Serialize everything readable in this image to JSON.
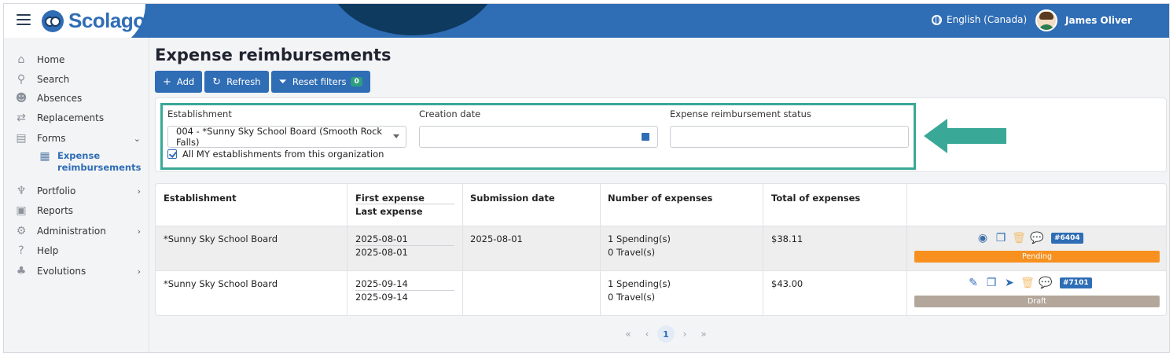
{
  "header": {
    "brand": "Scolago",
    "language": "English (Canada)",
    "user_name": "James Oliver"
  },
  "sidebar": {
    "items": [
      {
        "label": "Home",
        "icon": "home-icon"
      },
      {
        "label": "Search",
        "icon": "search-icon"
      },
      {
        "label": "Absences",
        "icon": "absences-icon"
      },
      {
        "label": "Replacements",
        "icon": "replacements-icon"
      },
      {
        "label": "Forms",
        "icon": "forms-icon"
      },
      {
        "label": "Portfolio",
        "icon": "trophy-icon"
      },
      {
        "label": "Reports",
        "icon": "reports-icon"
      },
      {
        "label": "Administration",
        "icon": "gear-icon"
      },
      {
        "label": "Help",
        "icon": "help-icon"
      },
      {
        "label": "Evolutions",
        "icon": "sprout-icon"
      }
    ],
    "sub_item": {
      "label": "Expense reimbursements",
      "icon": "document-icon"
    }
  },
  "page": {
    "title": "Expense reimbursements",
    "toolbar": {
      "add_label": "Add",
      "refresh_label": "Refresh",
      "reset_label": "Reset filters",
      "reset_count": "0"
    }
  },
  "filters": {
    "establishment_label": "Establishment",
    "establishment_value": "004 - *Sunny Sky School Board (Smooth Rock Falls)",
    "all_establishments_label": "All MY establishments from this organization",
    "creation_date_label": "Creation date",
    "creation_date_value": "",
    "status_label": "Expense reimbursement status",
    "status_value": ""
  },
  "table": {
    "headers": {
      "establishment": "Establishment",
      "first_expense": "First expense",
      "last_expense": "Last expense",
      "submission_date": "Submission date",
      "number_of_expenses": "Number of expenses",
      "total_of_expenses": "Total of expenses"
    },
    "rows": [
      {
        "establishment": "*Sunny Sky School Board",
        "first_expense": "2025-08-01",
        "last_expense": "2025-08-01",
        "submission_date": "2025-08-01",
        "spending": "1 Spending(s)",
        "travel": "0 Travel(s)",
        "total": "$38.11",
        "id": "#6404",
        "status": "Pending",
        "status_color": "#f7901e"
      },
      {
        "establishment": "*Sunny Sky School Board",
        "first_expense": "2025-09-14",
        "last_expense": "2025-09-14",
        "submission_date": "",
        "spending": "1 Spending(s)",
        "travel": "0 Travel(s)",
        "total": "$43.00",
        "id": "#7101",
        "status": "Draft",
        "status_color": "#b3a69a"
      }
    ]
  },
  "pagination": {
    "current_page": "1"
  },
  "colors": {
    "primary": "#2f6db5",
    "highlight": "#3aa897",
    "pending": "#f7901e",
    "draft": "#b3a69a"
  }
}
